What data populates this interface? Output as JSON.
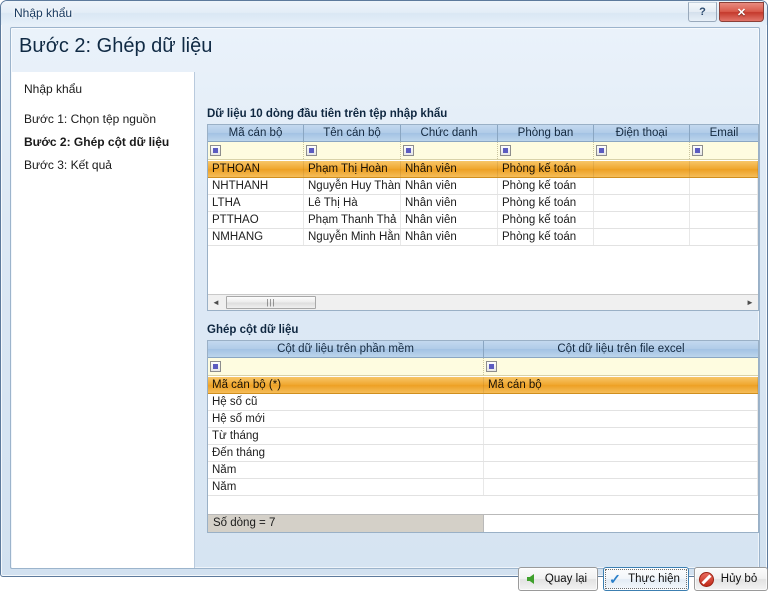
{
  "window": {
    "title": "Nhập khẩu",
    "help_label": "?",
    "close_label": "✕"
  },
  "page_title": "Bước 2: Ghép dữ liệu",
  "sidebar": {
    "header": "Nhập khẩu",
    "items": [
      {
        "label": "Bước 1: Chọn tệp nguồn"
      },
      {
        "label": "Bước 2: Ghép cột dữ liệu"
      },
      {
        "label": "Bước 3: Kết quả"
      }
    ]
  },
  "preview": {
    "label": "Dữ liệu 10 dòng đầu tiên trên tệp nhập khẩu",
    "columns": [
      "Mã cán bộ",
      "Tên cán bộ",
      "Chức danh",
      "Phòng ban",
      "Điện thoại",
      "Email"
    ],
    "rows": [
      {
        "selected": true,
        "cells": [
          "PTHOAN",
          "Phạm Thị Hoàn",
          "Nhân viên",
          "Phòng kế toán",
          "",
          ""
        ]
      },
      {
        "selected": false,
        "cells": [
          "NHTHANH",
          "Nguyễn Huy Thàn",
          "Nhân viên",
          "Phòng kế toán",
          "",
          ""
        ]
      },
      {
        "selected": false,
        "cells": [
          "LTHA",
          "Lê Thị Hà",
          "Nhân viên",
          "Phòng kế toán",
          "",
          ""
        ]
      },
      {
        "selected": false,
        "cells": [
          "PTTHAO",
          "Phạm Thanh Thả",
          "Nhân viên",
          "Phòng kế toán",
          "",
          ""
        ]
      },
      {
        "selected": false,
        "cells": [
          "NMHANG",
          "Nguyễn Minh Hằn",
          "Nhân viên",
          "Phòng kế toán",
          "",
          ""
        ]
      }
    ],
    "scrollbar": {
      "left_arrow": "◄",
      "right_arrow": "►",
      "thumb_grip": "|||"
    }
  },
  "mapping": {
    "label": "Ghép cột dữ liệu",
    "columns": [
      "Cột dữ liệu trên phần mềm",
      "Cột dữ liệu trên file excel"
    ],
    "rows": [
      {
        "selected": true,
        "cells": [
          "Mã cán bộ (*)",
          "Mã cán bộ"
        ]
      },
      {
        "selected": false,
        "cells": [
          "Hệ số cũ",
          ""
        ]
      },
      {
        "selected": false,
        "cells": [
          "Hệ số mới",
          ""
        ]
      },
      {
        "selected": false,
        "cells": [
          "Từ tháng",
          ""
        ]
      },
      {
        "selected": false,
        "cells": [
          "Đến tháng",
          ""
        ]
      },
      {
        "selected": false,
        "cells": [
          "Năm",
          ""
        ]
      },
      {
        "selected": false,
        "cells": [
          "Năm",
          ""
        ]
      }
    ],
    "footer_status": "Số dòng = 7"
  },
  "buttons": {
    "back": "Quay lại",
    "execute": "Thực hiện",
    "cancel": "Hủy bỏ"
  },
  "colors": {
    "selection_orange": "#f0a830",
    "header_blue": "#b0cbe8",
    "filter_yellow": "#fefce0",
    "close_red": "#c4392c",
    "accent_link": "#16385e"
  }
}
